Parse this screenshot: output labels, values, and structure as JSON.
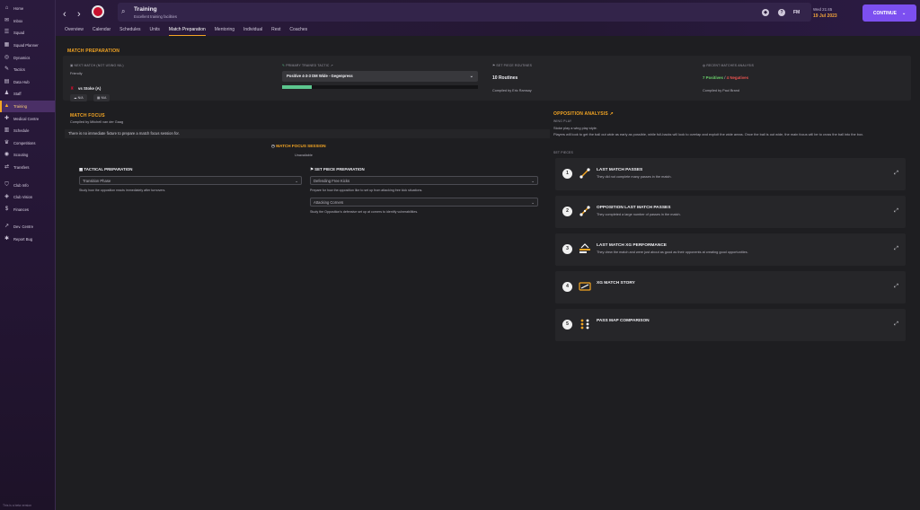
{
  "sidebar": {
    "items": [
      {
        "label": "Home",
        "icon": "home-icon",
        "glyph": "⌂",
        "active": false
      },
      {
        "label": "Inbox",
        "icon": "inbox-icon",
        "glyph": "✉",
        "active": false
      },
      {
        "label": "Squad",
        "icon": "squad-icon",
        "glyph": "☰",
        "active": false
      },
      {
        "label": "Squad Planner",
        "icon": "planner-icon",
        "glyph": "▦",
        "active": false
      },
      {
        "label": "Dynamics",
        "icon": "dynamics-icon",
        "glyph": "◎",
        "active": false
      },
      {
        "label": "Tactics",
        "icon": "tactics-icon",
        "glyph": "✎",
        "active": false
      },
      {
        "label": "Data Hub",
        "icon": "data-hub-icon",
        "glyph": "▤",
        "active": false
      },
      {
        "label": "Staff",
        "icon": "staff-icon",
        "glyph": "♟",
        "active": false
      },
      {
        "label": "Training",
        "icon": "training-icon",
        "glyph": "▲",
        "active": true
      },
      {
        "label": "Medical Centre",
        "icon": "medical-icon",
        "glyph": "✚",
        "active": false
      },
      {
        "label": "Schedule",
        "icon": "schedule-icon",
        "glyph": "▥",
        "active": false
      },
      {
        "label": "Competitions",
        "icon": "competitions-icon",
        "glyph": "♛",
        "active": false
      },
      {
        "label": "Scouting",
        "icon": "scouting-icon",
        "glyph": "◉",
        "active": false
      },
      {
        "label": "Transfers",
        "icon": "transfers-icon",
        "glyph": "⇄",
        "active": false
      }
    ],
    "items2": [
      {
        "label": "Club Info",
        "icon": "club-info-icon",
        "glyph": "⛉"
      },
      {
        "label": "Club Vision",
        "icon": "club-vision-icon",
        "glyph": "◈"
      },
      {
        "label": "Finances",
        "icon": "finances-icon",
        "glyph": "$"
      }
    ],
    "items3": [
      {
        "label": "Dev. Centre",
        "icon": "dev-centre-icon",
        "glyph": "↗"
      },
      {
        "label": "Report Bug",
        "icon": "report-bug-icon",
        "glyph": "✱"
      }
    ],
    "beta_note": "This is a beta version"
  },
  "topbar": {
    "title": "Training",
    "subtitle": "Excellent training facilities",
    "fm_label": "FM",
    "time": "Wed 21:45",
    "date": "19 Jul 2023",
    "continue_label": "CONTINUE",
    "accent": "#7c4ff0"
  },
  "tabs": [
    {
      "label": "Overview",
      "active": false
    },
    {
      "label": "Calendar",
      "active": false
    },
    {
      "label": "Schedules",
      "active": false
    },
    {
      "label": "Units",
      "active": false
    },
    {
      "label": "Match Preparation",
      "active": true
    },
    {
      "label": "Mentoring",
      "active": false
    },
    {
      "label": "Individual",
      "active": false
    },
    {
      "label": "Rest",
      "active": false
    },
    {
      "label": "Coaches",
      "active": false
    }
  ],
  "match_prep": {
    "title": "MATCH PREPARATION",
    "next_match_label": "NEXT MATCH (NOT USING NIL)",
    "competition": "Friendly",
    "fixture": "vs Stoke (A)",
    "pill1": "N/A",
    "pill2": "N/A",
    "tactic_label": "PRIMARY TRAINED TACTIC",
    "tactic_value": "Positive 4-3-3 DM Wide - Gegenpress",
    "tactic_familiarity": 0.15,
    "set_piece_label": "SET PIECE ROUTINES",
    "set_piece_value": "10 Routines",
    "set_piece_by": "Compiled by Eric Ramsay",
    "recent_label": "RECENT MATCHES ANALYSIS",
    "positives": "7 Positives",
    "separator": "/",
    "negatives": "4 Negatives",
    "recent_by": "Compiled by Paul Brand"
  },
  "match_focus": {
    "title": "MATCH FOCUS",
    "compiled_by": "Compiled by Mitchell van der Gaag",
    "info": "There is no immediate fixture to prepare a match focus session for.",
    "session_label": "MATCH FOCUS SESSION",
    "session_status": "Unavailable",
    "tactical_title": "TACTICAL PREPARATION",
    "tactical_select": "Transition Phase",
    "tactical_desc": "Study how the opposition reacts immediately after turnovers.",
    "setpiece_title": "SET PIECE PREPARATION",
    "setpiece_select1": "Defending Free Kicks",
    "setpiece_desc1": "Prepare for how the opposition like to set up from attacking free kick situations.",
    "setpiece_select2": "Attacking Corners",
    "setpiece_desc2": "Study the Opposition's defensive set up at corners to identify vulnerabilities."
  },
  "opposition": {
    "title": "OPPOSITION ANALYSIS",
    "wing_label": "WING PLAY",
    "wing_line1": "Stoke play a wing play style.",
    "wing_line2": "Players will look to get the ball out wide as early as possible, while full-backs will look to overlap and exploit the wide areas. Once the ball is out wide, the main focus will be to cross the ball into the box.",
    "set_pieces_label": "SET PIECES",
    "cards": [
      {
        "num": "1",
        "title": "LAST MATCH PASSES",
        "desc": "They did not complete many passes in the match."
      },
      {
        "num": "2",
        "title": "OPPOSITION LAST MATCH PASSES",
        "desc": "They completed a large number of passes in the match."
      },
      {
        "num": "3",
        "title": "LAST MATCH XG PERFORMANCE",
        "desc": "They drew the match and were just about as good as their opponents at creating good opportunities."
      },
      {
        "num": "4",
        "title": "XG MATCH STORY",
        "desc": ""
      },
      {
        "num": "5",
        "title": "PASS MAP COMPARISON",
        "desc": ""
      }
    ]
  }
}
